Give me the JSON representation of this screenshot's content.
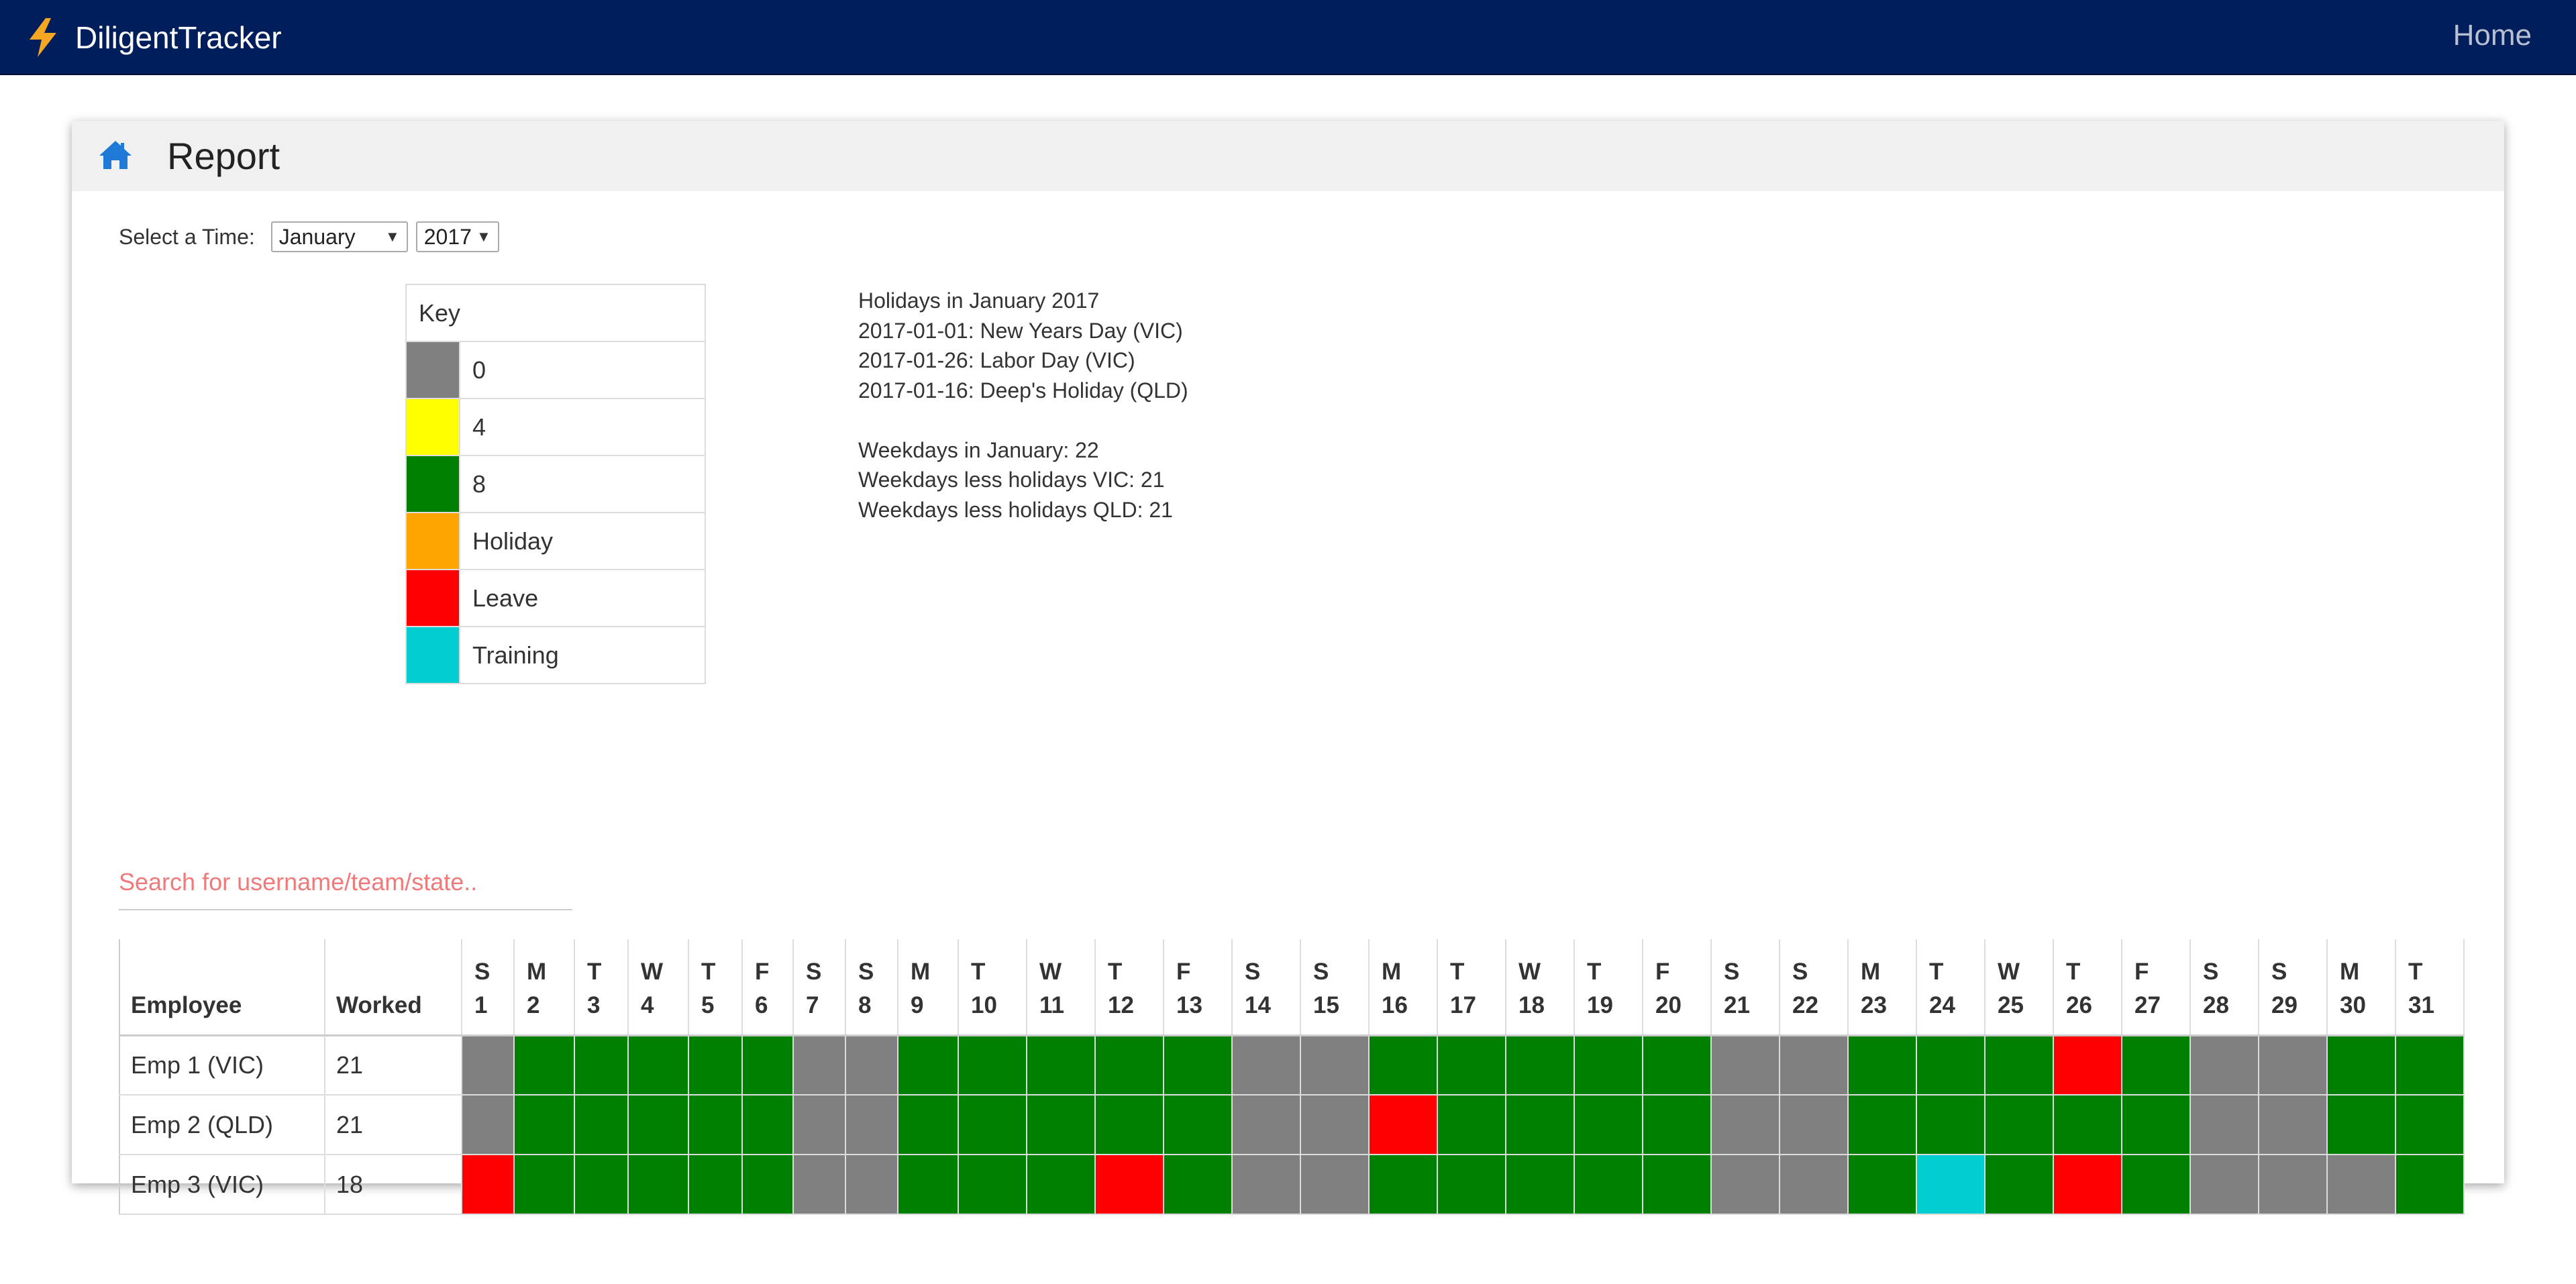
{
  "navbar": {
    "brand": "DiligentTracker",
    "home_link": "Home",
    "brand_icon": "lightning-bolt-icon"
  },
  "card": {
    "title": "Report",
    "home_icon": "home-icon"
  },
  "time_select": {
    "label": "Select a Time:",
    "month": "January",
    "year": "2017"
  },
  "key": {
    "header": "Key",
    "items": [
      {
        "label": "0",
        "color": "#808080"
      },
      {
        "label": "4",
        "color": "#ffff00"
      },
      {
        "label": "8",
        "color": "#008000"
      },
      {
        "label": "Holiday",
        "color": "#ffa500"
      },
      {
        "label": "Leave",
        "color": "#ff0000"
      },
      {
        "label": "Training",
        "color": "#00ced1"
      }
    ]
  },
  "holidays": {
    "title": "Holidays in January 2017",
    "items": [
      "2017-01-01: New Years Day (VIC)",
      "2017-01-26: Labor Day (VIC)",
      "2017-01-16: Deep's Holiday (QLD)"
    ],
    "weekdays": "Weekdays in January: 22",
    "less_vic": "Weekdays less holidays VIC: 21",
    "less_qld": "Weekdays less holidays QLD: 21"
  },
  "search": {
    "placeholder": "Search for username/team/state.."
  },
  "grid": {
    "header_employee": "Employee",
    "header_worked": "Worked",
    "days": [
      {
        "d": "S",
        "n": "1"
      },
      {
        "d": "M",
        "n": "2"
      },
      {
        "d": "T",
        "n": "3"
      },
      {
        "d": "W",
        "n": "4"
      },
      {
        "d": "T",
        "n": "5"
      },
      {
        "d": "F",
        "n": "6"
      },
      {
        "d": "S",
        "n": "7"
      },
      {
        "d": "S",
        "n": "8"
      },
      {
        "d": "M",
        "n": "9"
      },
      {
        "d": "T",
        "n": "10"
      },
      {
        "d": "W",
        "n": "11"
      },
      {
        "d": "T",
        "n": "12"
      },
      {
        "d": "F",
        "n": "13"
      },
      {
        "d": "S",
        "n": "14"
      },
      {
        "d": "S",
        "n": "15"
      },
      {
        "d": "M",
        "n": "16"
      },
      {
        "d": "T",
        "n": "17"
      },
      {
        "d": "W",
        "n": "18"
      },
      {
        "d": "T",
        "n": "19"
      },
      {
        "d": "F",
        "n": "20"
      },
      {
        "d": "S",
        "n": "21"
      },
      {
        "d": "S",
        "n": "22"
      },
      {
        "d": "M",
        "n": "23"
      },
      {
        "d": "T",
        "n": "24"
      },
      {
        "d": "W",
        "n": "25"
      },
      {
        "d": "T",
        "n": "26"
      },
      {
        "d": "F",
        "n": "27"
      },
      {
        "d": "S",
        "n": "28"
      },
      {
        "d": "S",
        "n": "29"
      },
      {
        "d": "M",
        "n": "30"
      },
      {
        "d": "T",
        "n": "31"
      }
    ],
    "colors": {
      "G": "#808080",
      "E": "#008000",
      "R": "#ff0000",
      "C": "#00ced1"
    },
    "rows": [
      {
        "employee": "Emp 1 (VIC)",
        "worked": "21",
        "cells": [
          "G",
          "E",
          "E",
          "E",
          "E",
          "E",
          "G",
          "G",
          "E",
          "E",
          "E",
          "E",
          "E",
          "G",
          "G",
          "E",
          "E",
          "E",
          "E",
          "E",
          "G",
          "G",
          "E",
          "E",
          "E",
          "R",
          "E",
          "G",
          "G",
          "E",
          "E"
        ]
      },
      {
        "employee": "Emp 2 (QLD)",
        "worked": "21",
        "cells": [
          "G",
          "E",
          "E",
          "E",
          "E",
          "E",
          "G",
          "G",
          "E",
          "E",
          "E",
          "E",
          "E",
          "G",
          "G",
          "R",
          "E",
          "E",
          "E",
          "E",
          "G",
          "G",
          "E",
          "E",
          "E",
          "E",
          "E",
          "G",
          "G",
          "E",
          "E"
        ]
      },
      {
        "employee": "Emp 3 (VIC)",
        "worked": "18",
        "cells": [
          "R",
          "E",
          "E",
          "E",
          "E",
          "E",
          "G",
          "G",
          "E",
          "E",
          "E",
          "R",
          "E",
          "G",
          "G",
          "E",
          "E",
          "E",
          "E",
          "E",
          "G",
          "G",
          "E",
          "C",
          "E",
          "R",
          "E",
          "G",
          "G",
          "G",
          "E"
        ]
      }
    ]
  }
}
